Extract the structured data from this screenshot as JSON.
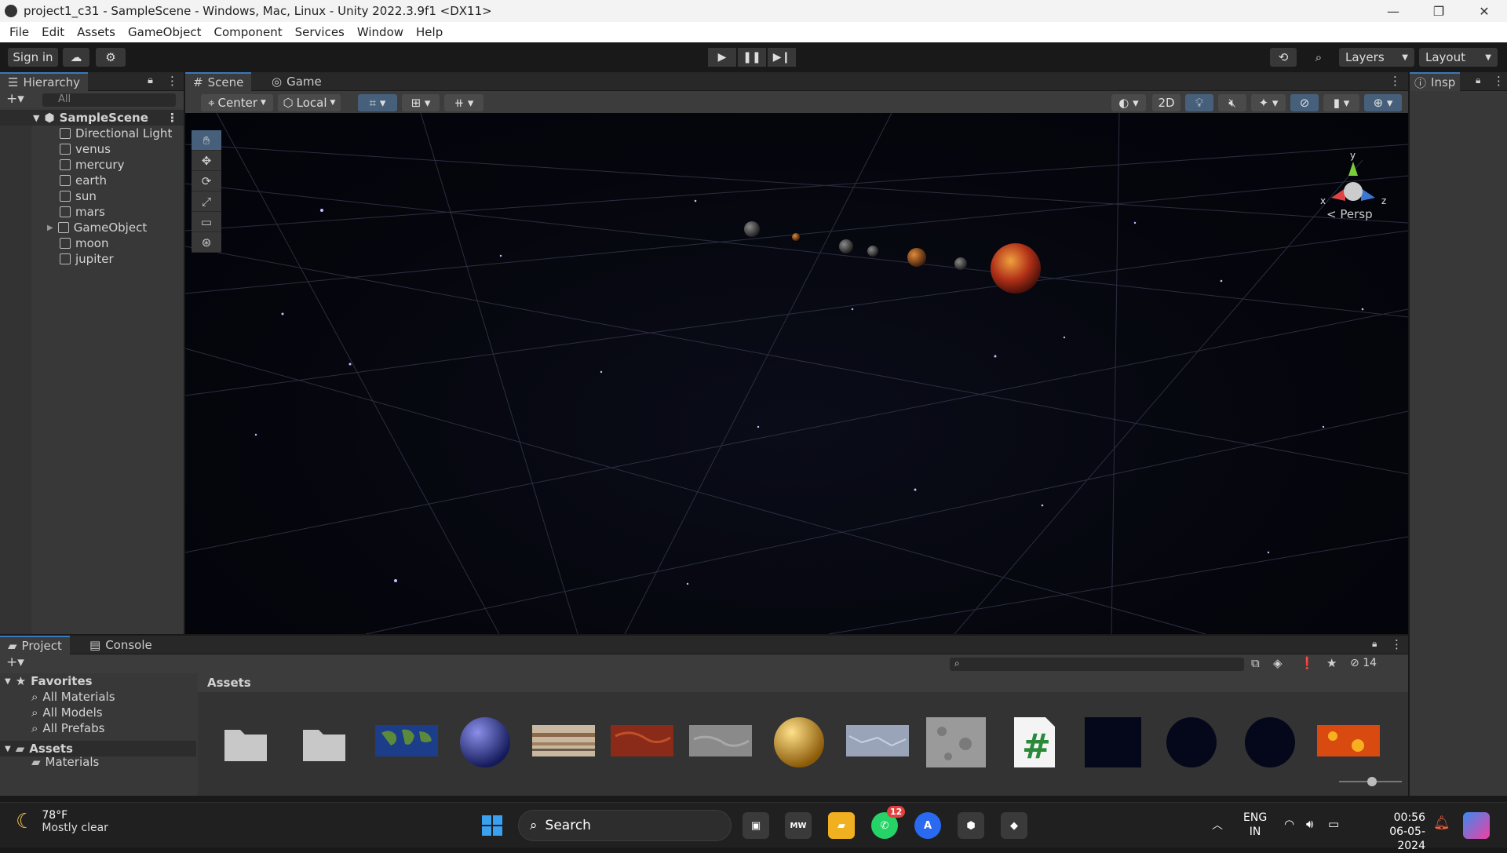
{
  "window": {
    "title": "project1_c31 - SampleScene - Windows, Mac, Linux - Unity 2022.3.9f1 <DX11>",
    "controls": {
      "minimize": "—",
      "restore": "❐",
      "close": "✕"
    }
  },
  "menu": [
    "File",
    "Edit",
    "Assets",
    "GameObject",
    "Component",
    "Services",
    "Window",
    "Help"
  ],
  "toolbar": {
    "sign_in": "Sign in",
    "layers_label": "Layers",
    "layout_label": "Layout"
  },
  "hierarchy": {
    "tab_label": "Hierarchy",
    "search_placeholder": "All",
    "scene_name": "SampleScene",
    "items": [
      {
        "label": "Directional Light",
        "expandable": false
      },
      {
        "label": "venus",
        "expandable": false
      },
      {
        "label": "mercury",
        "expandable": false
      },
      {
        "label": "earth",
        "expandable": false
      },
      {
        "label": "sun",
        "expandable": false
      },
      {
        "label": "mars",
        "expandable": false
      },
      {
        "label": "GameObject",
        "expandable": true
      },
      {
        "label": "moon",
        "expandable": false
      },
      {
        "label": "jupiter",
        "expandable": false
      }
    ]
  },
  "scene": {
    "tabs": [
      "Scene",
      "Game"
    ],
    "active_tab": "Scene",
    "pivot_mode": "Center",
    "pivot_rotation": "Local",
    "mode_2d": "2D",
    "persp_label": "Persp",
    "gizmo_axes": {
      "x": "x",
      "y": "y",
      "z": "z"
    }
  },
  "inspector": {
    "tab_label": "Insp"
  },
  "project": {
    "tabs": [
      "Project",
      "Console"
    ],
    "active_tab": "Project",
    "hidden_count": "14",
    "favorites_label": "Favorites",
    "favorites": [
      "All Materials",
      "All Models",
      "All Prefabs"
    ],
    "assets_root": "Assets",
    "assets_child": "Materials",
    "assets_header": "Assets",
    "thumbnails": [
      "folder",
      "folder",
      "earth-map",
      "blue-sphere",
      "jupiter-texture",
      "mars-texture",
      "grey-texture",
      "gold-sphere",
      "ice-texture",
      "moon-texture",
      "csharp-script",
      "dark-texture",
      "dark-sphere",
      "dark-sphere",
      "lava-texture"
    ]
  },
  "taskbar": {
    "weather_temp": "78°F",
    "weather_desc": "Mostly clear",
    "search_label": "Search",
    "whatsapp_badge": "12",
    "lang": "ENG",
    "region": "IN",
    "time": "00:56",
    "date": "06-05-2024"
  },
  "colors": {
    "accent": "#3a79bb",
    "editor_bg": "#383838",
    "viewport_bg": "#05060d"
  }
}
